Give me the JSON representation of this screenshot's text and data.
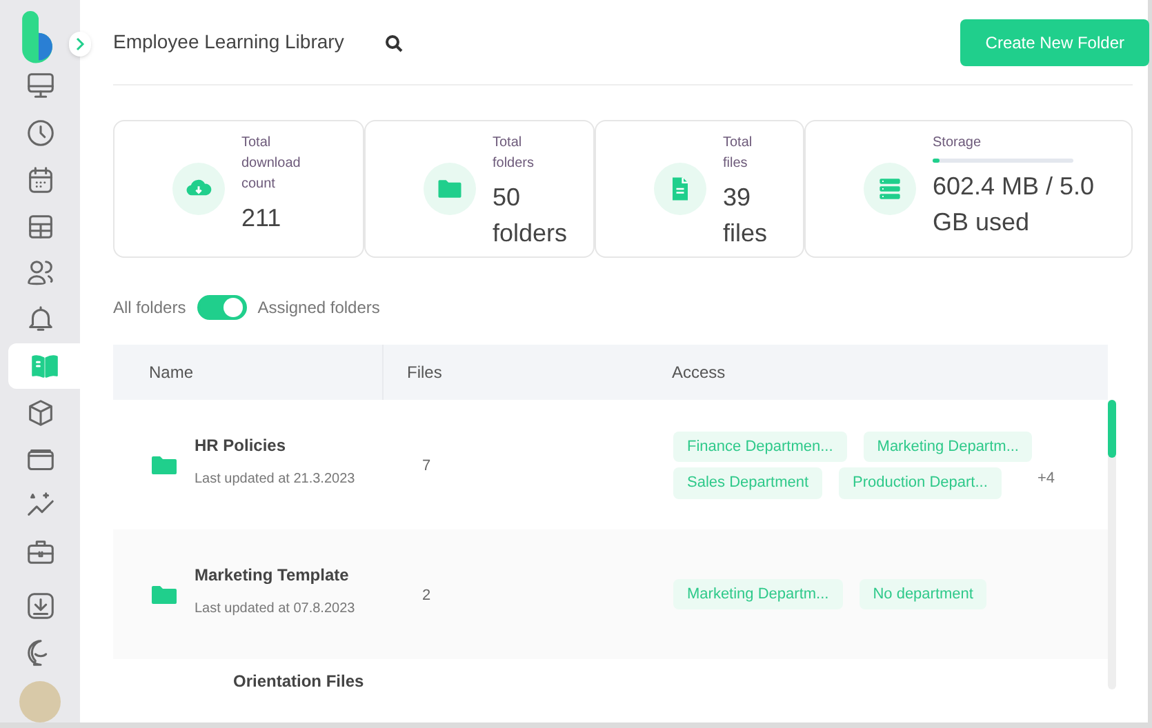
{
  "sidebar": {
    "items": [
      {
        "selected": false
      },
      {
        "selected": false
      },
      {
        "selected": false
      },
      {
        "selected": false
      },
      {
        "selected": false
      },
      {
        "selected": false
      },
      {
        "selected": true
      },
      {
        "selected": false
      },
      {
        "selected": false
      },
      {
        "selected": false
      },
      {
        "selected": false
      },
      {
        "selected": false
      },
      {
        "selected": false
      }
    ]
  },
  "header": {
    "title": "Employee Learning Library",
    "create_button": "Create New Folder"
  },
  "stats": [
    {
      "label": "Total download count",
      "value": "211"
    },
    {
      "label": "Total folders",
      "value": "50 folders"
    },
    {
      "label": "Total files",
      "value": "39 files"
    },
    {
      "label": "Storage",
      "value": "602.4 MB / 5.0 GB used",
      "level": 0.05
    }
  ],
  "filter": {
    "left_label": "All folders",
    "right_label": "Assigned folders",
    "on": true
  },
  "table": {
    "columns": [
      "Name",
      "Files",
      "Access"
    ],
    "rows": [
      {
        "name": "HR Policies",
        "updated": "Last updated at 21.3.2023",
        "files": "7",
        "access": [
          "Finance Departmen...",
          "Marketing Departm...",
          "Sales Department",
          "Production Depart..."
        ],
        "more": "+4"
      },
      {
        "name": "Marketing Template",
        "updated": "Last updated at 07.8.2023",
        "files": "2",
        "access": [
          "Marketing Departm...",
          "No department"
        ]
      },
      {
        "name": "Orientation Files"
      }
    ]
  }
}
